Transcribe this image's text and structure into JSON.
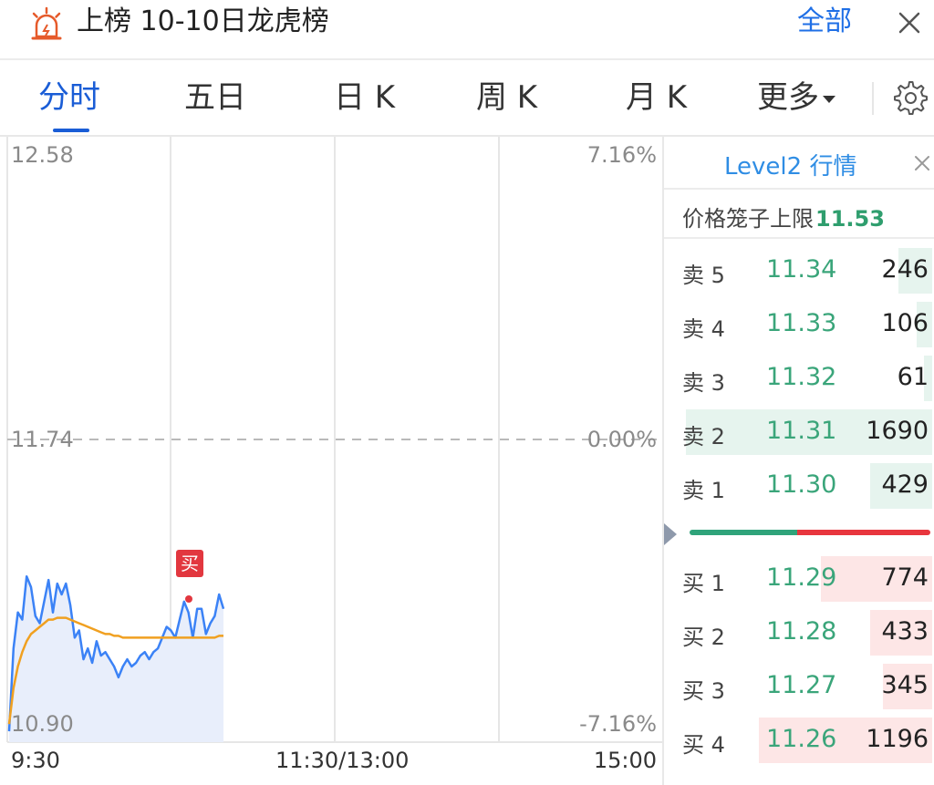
{
  "header": {
    "title": "上榜 10-10日龙虎榜",
    "all_label": "全部",
    "alarm_icon": "alarm-icon",
    "close_icon": "close-icon"
  },
  "tabs": [
    {
      "label": "分时",
      "active": true
    },
    {
      "label": "五日",
      "active": false
    },
    {
      "label": "日 K",
      "active": false
    },
    {
      "label": "周 K",
      "active": false
    },
    {
      "label": "月 K",
      "active": false
    },
    {
      "label": "更多",
      "active": false
    }
  ],
  "settings_icon": "gear-icon",
  "chart": {
    "price_high": "12.58",
    "price_mid": "11.74",
    "price_low": "10.90",
    "pct_high": "7.16%",
    "pct_mid": "0.00%",
    "pct_low": "-7.16%",
    "time_start": "9:30",
    "time_mid": "11:30/13:00",
    "time_end": "15:00",
    "buy_marker": "买",
    "colors": {
      "price_line": "#3b82f6",
      "avg_line": "#f0a020",
      "area": "#e8eefb"
    }
  },
  "chart_data": {
    "type": "line",
    "ylim": [
      10.9,
      12.58
    ],
    "y_ticks": [
      "12.58",
      "11.74",
      "10.90"
    ],
    "pct_ticks": [
      "7.16%",
      "0.00%",
      "-7.16%"
    ],
    "x_ticks": [
      "9:30",
      "11:30/13:00",
      "15:00"
    ],
    "series": [
      {
        "values": [
          10.93,
          11.16,
          11.26,
          11.24,
          11.36,
          11.33,
          11.25,
          11.23,
          11.29,
          11.35,
          11.26,
          11.34,
          11.31,
          11.34,
          11.28,
          11.19,
          11.21,
          11.13,
          11.16,
          11.12,
          11.18,
          11.14,
          11.15,
          11.13,
          11.11,
          11.08,
          11.11,
          11.13,
          11.11,
          11.12,
          11.14,
          11.15,
          11.13,
          11.15,
          11.16,
          11.19,
          11.22,
          11.21,
          11.19,
          11.24,
          11.29,
          11.26,
          11.19,
          11.27,
          11.27,
          11.2,
          11.23,
          11.25,
          11.31,
          11.27
        ]
      },
      {
        "values": [
          10.95,
          11.05,
          11.11,
          11.15,
          11.18,
          11.2,
          11.21,
          11.22,
          11.23,
          11.24,
          11.24,
          11.245,
          11.245,
          11.245,
          11.24,
          11.235,
          11.23,
          11.225,
          11.22,
          11.215,
          11.21,
          11.205,
          11.2,
          11.2,
          11.195,
          11.195,
          11.19,
          11.19,
          11.19,
          11.19,
          11.19,
          11.19,
          11.19,
          11.19,
          11.19,
          11.19,
          11.19,
          11.19,
          11.19,
          11.19,
          11.19,
          11.19,
          11.19,
          11.19,
          11.19,
          11.19,
          11.19,
          11.19,
          11.195,
          11.195
        ]
      }
    ],
    "grid": true
  },
  "level2": {
    "title": "Level2 行情",
    "cage_label": "价格笼子上限",
    "cage_value": "11.53",
    "sell": [
      {
        "label": "卖 5",
        "price": "11.34",
        "vol": "246",
        "depth": 0.13
      },
      {
        "label": "卖 4",
        "price": "11.33",
        "vol": "106",
        "depth": 0.06
      },
      {
        "label": "卖 3",
        "price": "11.32",
        "vol": "61",
        "depth": 0.03
      },
      {
        "label": "卖 2",
        "price": "11.31",
        "vol": "1690",
        "depth": 0.95
      },
      {
        "label": "卖 1",
        "price": "11.30",
        "vol": "429",
        "depth": 0.24
      }
    ],
    "buy": [
      {
        "label": "买 1",
        "price": "11.29",
        "vol": "774",
        "depth": 0.43
      },
      {
        "label": "买 2",
        "price": "11.28",
        "vol": "433",
        "depth": 0.24
      },
      {
        "label": "买 3",
        "price": "11.27",
        "vol": "345",
        "depth": 0.19
      },
      {
        "label": "买 4",
        "price": "11.26",
        "vol": "1196",
        "depth": 0.67
      }
    ]
  }
}
